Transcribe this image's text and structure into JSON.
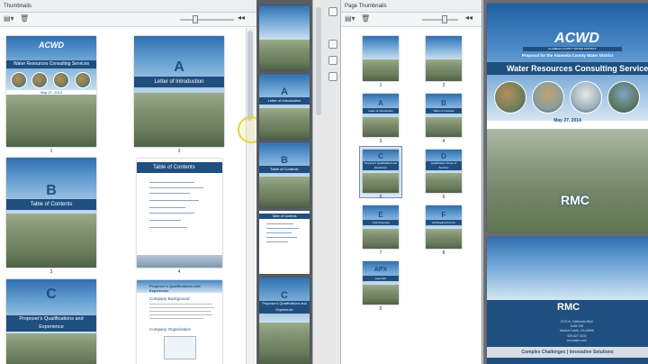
{
  "left_panel": {
    "title": "Thumbnails",
    "pages": [
      {
        "num": "1",
        "kind": "cover",
        "logo": "ACWD",
        "heading": "Water Resources Consulting Services",
        "date": "May 27, 2014"
      },
      {
        "num": "2",
        "kind": "tab",
        "letter": "A",
        "label": "Letter of Introduction"
      },
      {
        "num": "3",
        "kind": "tab",
        "letter": "B",
        "label": "Table of Contents"
      },
      {
        "num": "4",
        "kind": "toc",
        "label": "Table of Contents"
      },
      {
        "num": "5",
        "kind": "tab",
        "letter": "C",
        "label": "Proposer's Qualifications and Experience"
      },
      {
        "num": "6",
        "kind": "text",
        "heading": "Proposer's Qualifications and Experience",
        "sub1": "Company Background",
        "sub2": "Company Organization"
      }
    ]
  },
  "mid_strip": {
    "pages": [
      {
        "letter": "",
        "label": ""
      },
      {
        "letter": "A",
        "label": "Letter of Introduction"
      },
      {
        "letter": "B",
        "label": "Table of Contents"
      },
      {
        "letter": "",
        "label": "Table of Contents"
      },
      {
        "letter": "C",
        "label": "Proposer's Qualifications and Experience"
      }
    ]
  },
  "right_panel": {
    "title": "Page Thumbnails",
    "pages": [
      {
        "num": "1",
        "letter": "",
        "label": ""
      },
      {
        "num": "2",
        "letter": "",
        "label": ""
      },
      {
        "num": "3",
        "letter": "A",
        "label": "Letter of Introduction"
      },
      {
        "num": "4",
        "letter": "B",
        "label": "Table of Contents"
      },
      {
        "num": "5",
        "letter": "C",
        "label": "Proposer's Qualifications and Experience"
      },
      {
        "num": "6",
        "letter": "D",
        "label": "Qualifications Scope of Services"
      },
      {
        "num": "7",
        "letter": "E",
        "label": "Cost Proposal"
      },
      {
        "num": "8",
        "letter": "F",
        "label": "All Required Forms"
      },
      {
        "num": "9",
        "letter": "APX",
        "label": "Appendix"
      }
    ]
  },
  "doc_view": {
    "logo": "ACWD",
    "logo_sub": "ALAMEDA COUNTY WATER DISTRICT",
    "proposal_line": "Proposal for the Alameda County Water District",
    "heading": "Water Resources Consulting Services",
    "date": "May 27, 2014",
    "firm": "RMC",
    "firm2": "RMC",
    "address1": "2175 N. California Blvd.",
    "address2": "Suite 315",
    "address3": "Walnut Creek, CA 94596",
    "phone": "925.627.4100",
    "web": "rmcwater.com",
    "tagline": "Complex Challenges | Innovative Solutions"
  }
}
